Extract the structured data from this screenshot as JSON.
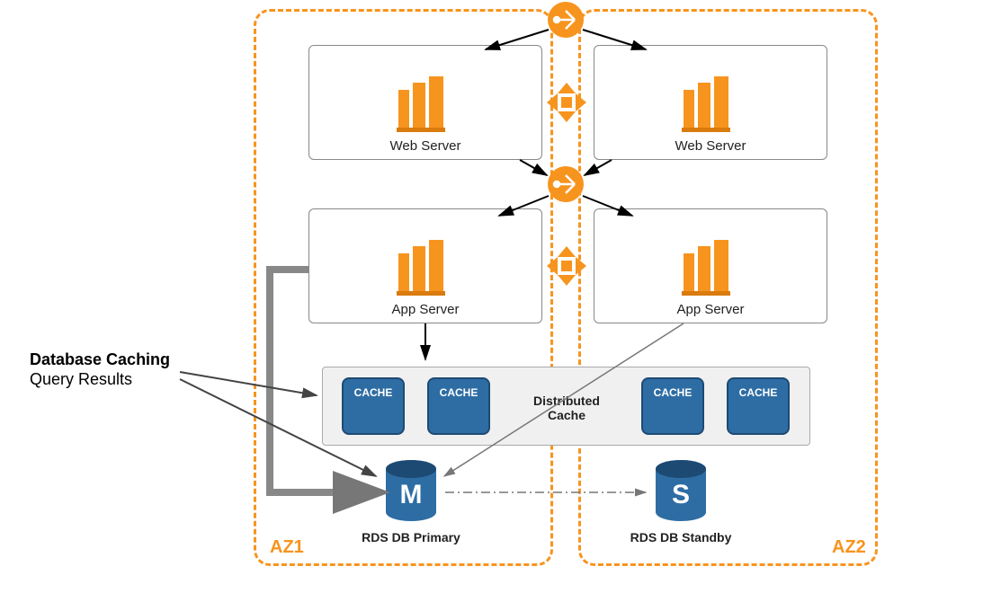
{
  "az": {
    "left_label": "AZ1",
    "right_label": "AZ2"
  },
  "servers": {
    "web_left": "Web Server",
    "web_right": "Web Server",
    "app_left": "App Server",
    "app_right": "App Server"
  },
  "cache": {
    "box_label": "CACHE",
    "panel_label": "Distributed Cache"
  },
  "db": {
    "primary_letter": "M",
    "primary_label": "RDS DB Primary",
    "standby_letter": "S",
    "standby_label": "RDS DB Standby"
  },
  "callout": {
    "title": "Database Caching",
    "subtitle": "Query Results"
  },
  "colors": {
    "orange": "#F7941E",
    "blue": "#2E6DA4",
    "dark": "#244a6e",
    "grey": "#777"
  }
}
